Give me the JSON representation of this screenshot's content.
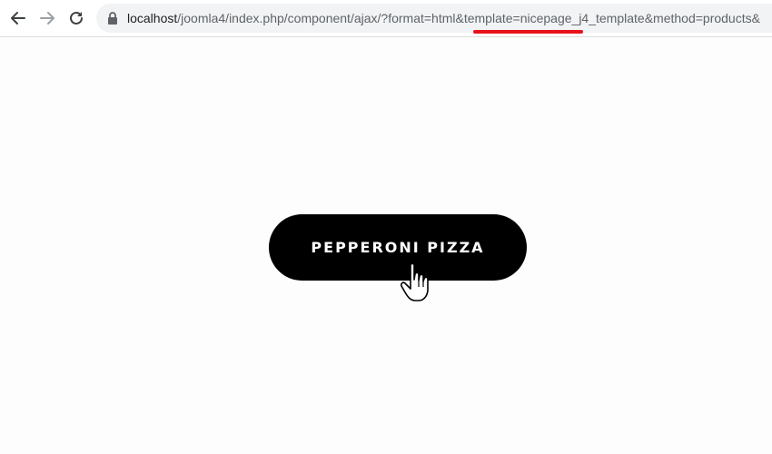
{
  "browser": {
    "url_host": "localhost",
    "url_path": "/joomla4/index.php/component/ajax/?format=html&template=nicepage_j4_template&method=products&",
    "icons": {
      "back": "arrow-left-icon",
      "forward": "arrow-right-icon",
      "reload": "reload-icon",
      "lock": "lock-icon"
    },
    "highlight_color": "#e8121b"
  },
  "page": {
    "button_label": "PEPPERONI PIZZA",
    "button_color": "#000000",
    "button_text_color": "#ffffff",
    "cursor_icon": "hand-pointer-icon"
  }
}
